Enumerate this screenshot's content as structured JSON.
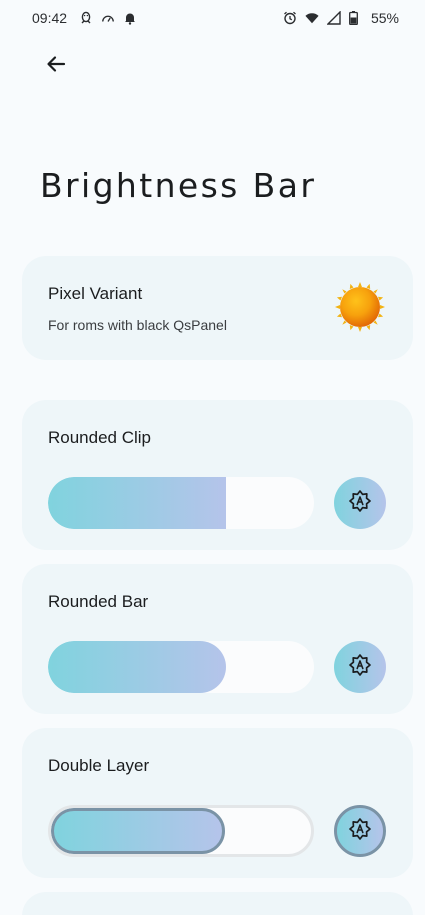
{
  "status_bar": {
    "time": "09:42",
    "battery": "55%",
    "left_icons": [
      "penguin-icon",
      "speedometer-icon",
      "notification-bell-icon"
    ],
    "right_icons": [
      "alarm-icon",
      "wifi-icon",
      "cell-signal-icon",
      "battery-icon"
    ]
  },
  "header": {
    "back_icon": "arrow-left-icon",
    "title": "Brightness Bar"
  },
  "pixel_variant": {
    "title": "Pixel Variant",
    "subtitle": "For roms with black QsPanel",
    "icon": "sun-icon"
  },
  "sliders": [
    {
      "title": "Rounded Clip",
      "style": "clip",
      "level": 0.67,
      "icon": "auto-brightness-icon"
    },
    {
      "title": "Rounded Bar",
      "style": "rounded",
      "level": 0.67,
      "icon": "auto-brightness-icon"
    },
    {
      "title": "Double Layer",
      "style": "double",
      "level": 0.67,
      "icon": "auto-brightness-icon"
    }
  ],
  "colors": {
    "accent_start": "#80d3de",
    "accent_end": "#b5c4ea",
    "card_bg": "#eef6f9",
    "outline": "#7a93a6"
  }
}
